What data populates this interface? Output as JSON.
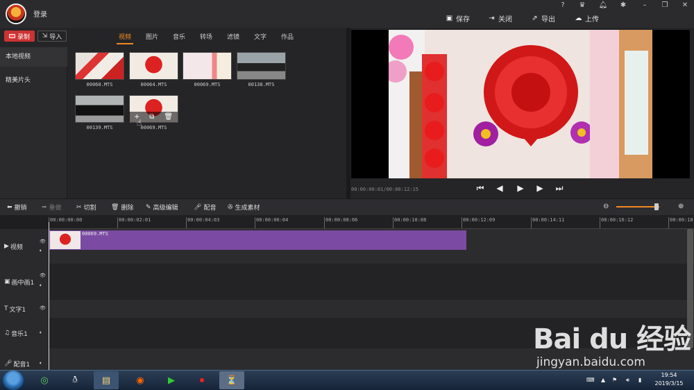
{
  "titlebar": {
    "login_label": "登录",
    "window_controls": [
      "?",
      "VIP",
      "bell",
      "gear",
      "minimize",
      "restore",
      "close"
    ],
    "actions": [
      {
        "label": "保存",
        "icon": "save-icon"
      },
      {
        "label": "关闭",
        "icon": "exit-icon"
      },
      {
        "label": "导出",
        "icon": "share-icon"
      },
      {
        "label": "上传",
        "icon": "cloud-upload-icon"
      }
    ]
  },
  "library": {
    "record_label": "录制",
    "import_label": "导入",
    "tabs": [
      "视频",
      "图片",
      "音乐",
      "转场",
      "滤镜",
      "文字",
      "作品"
    ],
    "active_tab": "视频",
    "sidebar": [
      "本地视频",
      "精美片头"
    ],
    "media": [
      "00060.MTS",
      "00064.MTS",
      "00069.MTS",
      "00138.MTS",
      "00139.MTS",
      "00069.MTS"
    ]
  },
  "preview": {
    "timecode": "00:00:00:01/00:00:12:15"
  },
  "edit_toolbar": {
    "undo": "撤销",
    "redo": "重做",
    "cut": "切割",
    "delete": "删除",
    "advanced_edit": "高级编辑",
    "dub": "配音",
    "generate": "生成素材",
    "zoom_level": 0.9
  },
  "timeline": {
    "ruler": [
      "00:00:00:00",
      "00:00:02:01",
      "00:00:04:03",
      "00:00:06:04",
      "00:00:08:06",
      "00:00:10:08",
      "00:00:12:09",
      "00:00:14:11",
      "00:00:16:12",
      "00:00:18:"
    ],
    "tracks": [
      "视频",
      "画中画1",
      "文字1",
      "音乐1",
      "配音1"
    ],
    "clip_label": "00069.MTS"
  },
  "taskbar": {
    "time": "19:54",
    "date": "2019/3/15"
  },
  "watermark": {
    "logo_text": "Bai du 经验",
    "url": "jingyan.baidu.com"
  },
  "colors": {
    "accent": "#f08a24",
    "clip": "#7b4aa3",
    "record": "#cc3333"
  }
}
